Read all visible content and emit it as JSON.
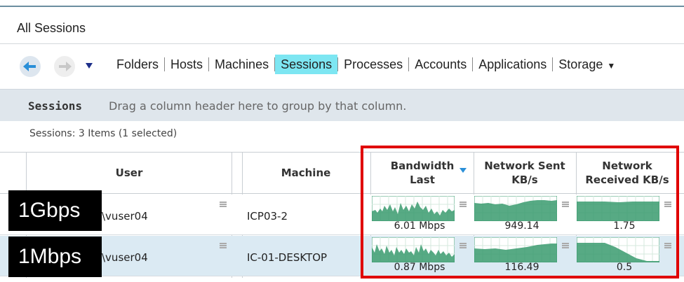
{
  "window": {
    "title": "All Sessions"
  },
  "nav": {
    "tabs": [
      {
        "label": "Folders",
        "active": false
      },
      {
        "label": "Hosts",
        "active": false
      },
      {
        "label": "Machines",
        "active": false
      },
      {
        "label": "Sessions",
        "active": true
      },
      {
        "label": "Processes",
        "active": false
      },
      {
        "label": "Accounts",
        "active": false
      },
      {
        "label": "Applications",
        "active": false
      },
      {
        "label": "Storage",
        "active": false,
        "has_dropdown": true
      }
    ],
    "back_icon": "arrow-left-icon",
    "forward_icon": "arrow-right-icon",
    "history_icon": "triangle-down-icon",
    "accent": "#7de6f2"
  },
  "group_bar": {
    "title": "Sessions",
    "hint": "Drag a column header here to group by that column."
  },
  "status": {
    "count": "Sessions: 3 Items (1 selected)"
  },
  "columns": {
    "user": "User",
    "machine": "Machine",
    "bandwidth_line1": "Bandwidth",
    "bandwidth_line2": "Last",
    "sent_line1": "Network Sent",
    "sent_line2": "KB/s",
    "received_line1": "Network",
    "received_line2": "Received KB/s"
  },
  "rows": [
    {
      "user": "\\vuser04",
      "machine": "ICP03-2",
      "bandwidth": "6.01 Mbps",
      "sent": "949.14",
      "received": "1.75",
      "selected": false
    },
    {
      "user": "\\vuser04",
      "machine": "IC-01-DESKTOP",
      "bandwidth": "0.87 Mbps",
      "sent": "116.49",
      "received": "0.5",
      "selected": true
    }
  ],
  "annotations": {
    "label1": "1Gbps",
    "label2": "1Mbps",
    "highlight_color": "#e00000"
  },
  "colors": {
    "spark_fill": "#3a9b6f",
    "spark_line": "#1f6e4a",
    "selected_row": "#dbeaf3"
  }
}
